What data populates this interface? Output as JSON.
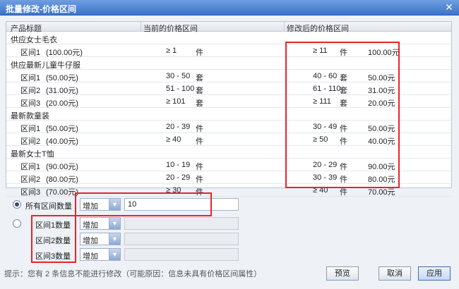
{
  "window": {
    "title": "批量修改-价格区间",
    "close_label": "✕"
  },
  "table": {
    "headers": [
      "产品标题",
      "当前的价格区间",
      "修改后的价格区间"
    ],
    "rows": [
      {
        "type": "product",
        "title": "供应女士毛衣"
      },
      {
        "type": "range",
        "name": "区间1",
        "price": "(100.00元)",
        "cur_range": "≥ 1",
        "cur_unit": "件",
        "new_range": "≥ 11",
        "new_unit": "件",
        "new_price": "100.00元"
      },
      {
        "type": "product",
        "title": "供应最新儿童牛仔服"
      },
      {
        "type": "range",
        "name": "区间1",
        "price": "(50.00元)",
        "cur_range": "30 - 50",
        "cur_unit": "套",
        "new_range": "40 - 60",
        "new_unit": "套",
        "new_price": "50.00元"
      },
      {
        "type": "range",
        "name": "区间2",
        "price": "(31.00元)",
        "cur_range": "51 - 100",
        "cur_unit": "套",
        "new_range": "61 - 110",
        "new_unit": "套",
        "new_price": "31.00元"
      },
      {
        "type": "range",
        "name": "区间3",
        "price": "(20.00元)",
        "cur_range": "≥ 101",
        "cur_unit": "套",
        "new_range": "≥ 111",
        "new_unit": "套",
        "new_price": "20.00元"
      },
      {
        "type": "product",
        "title": "最新款童装"
      },
      {
        "type": "range",
        "name": "区间1",
        "price": "(50.00元)",
        "cur_range": "20 - 39",
        "cur_unit": "件",
        "new_range": "30 - 49",
        "new_unit": "件",
        "new_price": "50.00元"
      },
      {
        "type": "range",
        "name": "区间2",
        "price": "(40.00元)",
        "cur_range": "≥ 40",
        "cur_unit": "件",
        "new_range": "≥ 50",
        "new_unit": "件",
        "new_price": "40.00元"
      },
      {
        "type": "product",
        "title": "最新女士T恤"
      },
      {
        "type": "range",
        "name": "区间1",
        "price": "(90.00元)",
        "cur_range": "10 - 19",
        "cur_unit": "件",
        "new_range": "20 - 29",
        "new_unit": "件",
        "new_price": "90.00元"
      },
      {
        "type": "range",
        "name": "区间2",
        "price": "(80.00元)",
        "cur_range": "20 - 29",
        "cur_unit": "件",
        "new_range": "30 - 39",
        "new_unit": "件",
        "new_price": "80.00元"
      },
      {
        "type": "range",
        "name": "区间3",
        "price": "(70.00元)",
        "cur_range": "≥ 30",
        "cur_unit": "件",
        "new_range": "≥ 40",
        "new_unit": "件",
        "new_price": "70.00元"
      }
    ]
  },
  "form": {
    "all_label": "所有区间数量",
    "all_op": "增加",
    "all_value": "10",
    "range_labels": [
      "区间1数量",
      "区间2数量",
      "区间3数量"
    ],
    "range_ops": [
      "增加",
      "增加",
      "增加"
    ]
  },
  "hint": "提示：您有 2 条信息不能进行修改（可能原因：信息未具有价格区间属性）",
  "buttons": {
    "preview": "预览",
    "cancel": "取消",
    "apply": "应用"
  }
}
